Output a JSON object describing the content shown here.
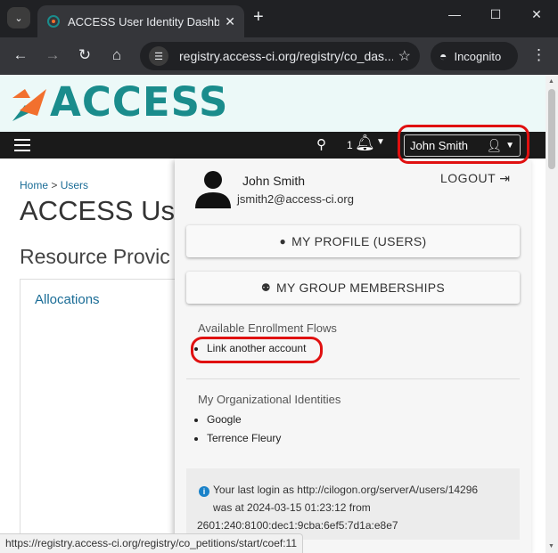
{
  "browser": {
    "tab_title": "ACCESS User Identity Dashboard",
    "new_tab": "+",
    "url": "registry.access-ci.org/registry/co_das...",
    "incognito_label": "Incognito",
    "minimize": "—",
    "maximize": "☐",
    "close": "✕",
    "tab_close": "✕"
  },
  "header": {
    "logo_text": "ACCESS",
    "notification_count": "1",
    "user_name": "John Smith"
  },
  "main": {
    "breadcrumb_home": "Home",
    "breadcrumb_sep": " > ",
    "breadcrumb_users": "Users",
    "title": "ACCESS Use",
    "section_title": "Resource Provic",
    "card_link": "Allocations"
  },
  "dropdown": {
    "name": "John Smith",
    "email": "jsmith2@access-ci.org",
    "logout_label": "LOGOUT",
    "my_profile_label": "MY PROFILE (USERS)",
    "group_memberships_label": "MY GROUP MEMBERSHIPS",
    "enrollment_flows_heading": "Available Enrollment Flows",
    "enrollment_flows": [
      "Link another account"
    ],
    "org_identities_heading": "My Organizational Identities",
    "org_identities": [
      "Google",
      "Terrence Fleury"
    ],
    "last_login_line1": "Your last login as http://cilogon.org/serverA/users/14296",
    "last_login_line2": "was at 2024-03-15 01:23:12 from",
    "last_login_line3": "2601:240:8100:dec1:9cba:6ef5:7d1a:e8e7"
  },
  "status_bar": {
    "url": "https://registry.access-ci.org/registry/co_petitions/start/coef:11"
  },
  "colors": {
    "brand_teal": "#1a8c8c",
    "brand_orange": "#f2702e",
    "navbar": "#1a1a1a",
    "link": "#1a6c96",
    "highlight": "#e01010"
  },
  "icons": {
    "search": "search-icon",
    "bell": "bell-icon",
    "user": "user-icon",
    "logout": "logout-icon",
    "info": "info-icon"
  }
}
